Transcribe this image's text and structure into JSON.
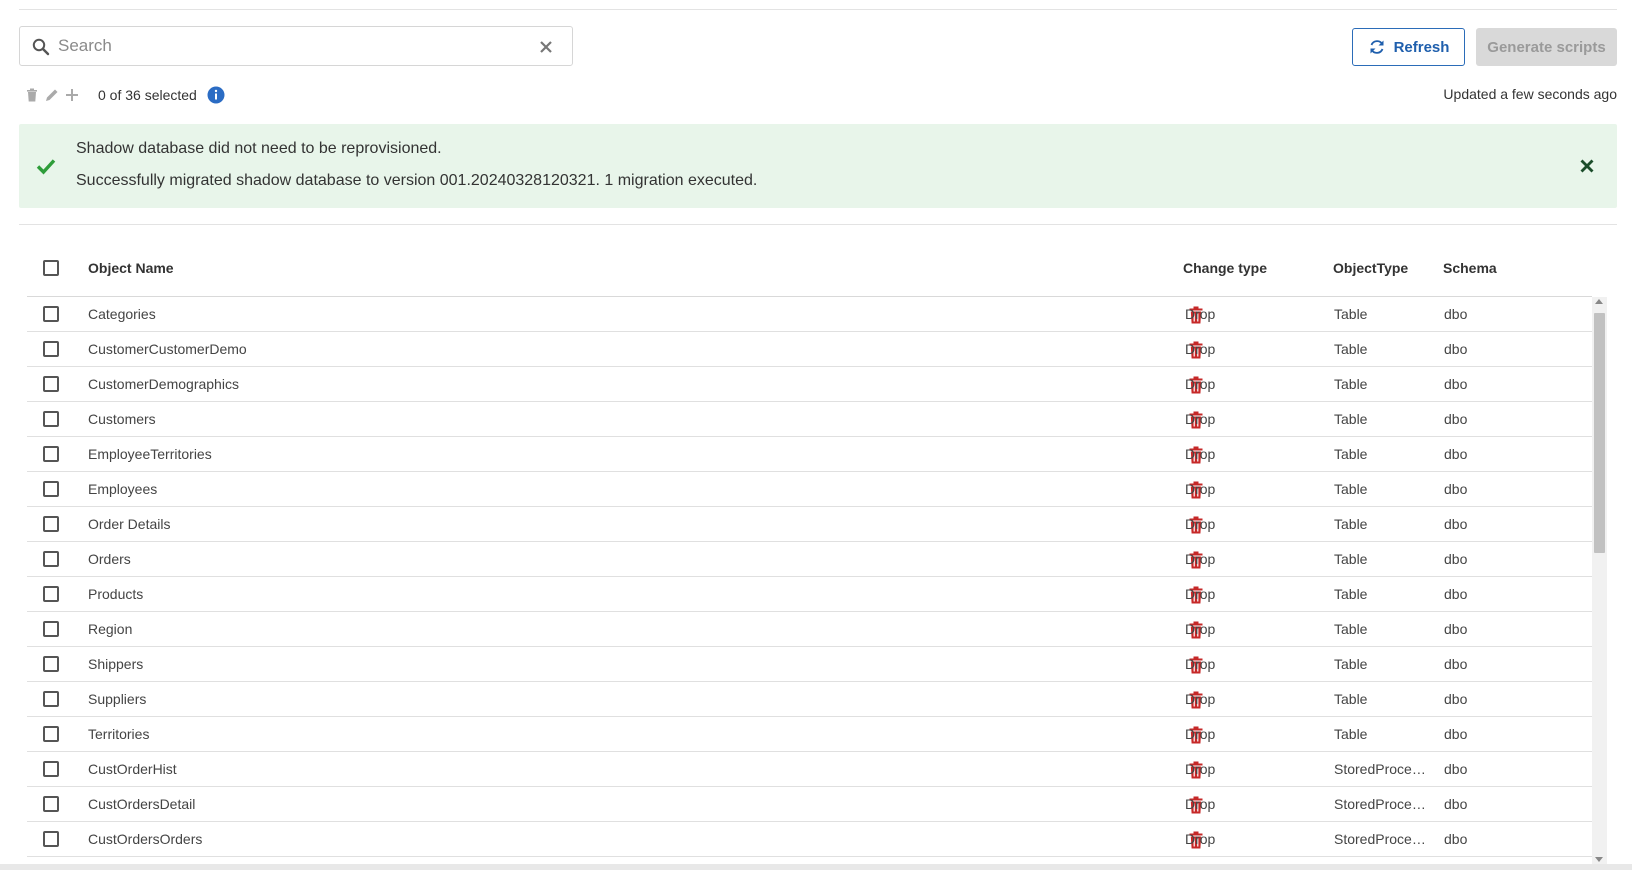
{
  "search": {
    "placeholder": "Search",
    "value": ""
  },
  "buttons": {
    "refresh": "Refresh",
    "generate": "Generate scripts"
  },
  "toolbar": {
    "selection": "0 of 36 selected",
    "updated": "Updated a few seconds ago"
  },
  "alert": {
    "line1": "Shadow database did not need to be reprovisioned.",
    "line2": "Successfully migrated shadow database to version 001.20240328120321. 1 migration executed."
  },
  "table": {
    "headers": {
      "name": "Object Name",
      "change": "Change type",
      "object_type": "ObjectType",
      "schema": "Schema"
    },
    "rows": [
      {
        "name": "Categories",
        "change": "Drop",
        "object_type": "Table",
        "schema": "dbo"
      },
      {
        "name": "CustomerCustomerDemo",
        "change": "Drop",
        "object_type": "Table",
        "schema": "dbo"
      },
      {
        "name": "CustomerDemographics",
        "change": "Drop",
        "object_type": "Table",
        "schema": "dbo"
      },
      {
        "name": "Customers",
        "change": "Drop",
        "object_type": "Table",
        "schema": "dbo"
      },
      {
        "name": "EmployeeTerritories",
        "change": "Drop",
        "object_type": "Table",
        "schema": "dbo"
      },
      {
        "name": "Employees",
        "change": "Drop",
        "object_type": "Table",
        "schema": "dbo"
      },
      {
        "name": "Order Details",
        "change": "Drop",
        "object_type": "Table",
        "schema": "dbo"
      },
      {
        "name": "Orders",
        "change": "Drop",
        "object_type": "Table",
        "schema": "dbo"
      },
      {
        "name": "Products",
        "change": "Drop",
        "object_type": "Table",
        "schema": "dbo"
      },
      {
        "name": "Region",
        "change": "Drop",
        "object_type": "Table",
        "schema": "dbo"
      },
      {
        "name": "Shippers",
        "change": "Drop",
        "object_type": "Table",
        "schema": "dbo"
      },
      {
        "name": "Suppliers",
        "change": "Drop",
        "object_type": "Table",
        "schema": "dbo"
      },
      {
        "name": "Territories",
        "change": "Drop",
        "object_type": "Table",
        "schema": "dbo"
      },
      {
        "name": "CustOrderHist",
        "change": "Drop",
        "object_type": "StoredProce…",
        "schema": "dbo"
      },
      {
        "name": "CustOrdersDetail",
        "change": "Drop",
        "object_type": "StoredProce…",
        "schema": "dbo"
      },
      {
        "name": "CustOrdersOrders",
        "change": "Drop",
        "object_type": "StoredProce…",
        "schema": "dbo"
      }
    ]
  },
  "colors": {
    "accent": "#1f5fad",
    "success_bg": "#e8f5ea",
    "success_icon": "#2e9d3a",
    "drop_red": "#c62828"
  },
  "icons": [
    "search-icon",
    "clear-icon",
    "refresh-icon",
    "trash-icon",
    "pencil-icon",
    "plus-icon",
    "info-icon",
    "check-icon",
    "close-icon"
  ]
}
